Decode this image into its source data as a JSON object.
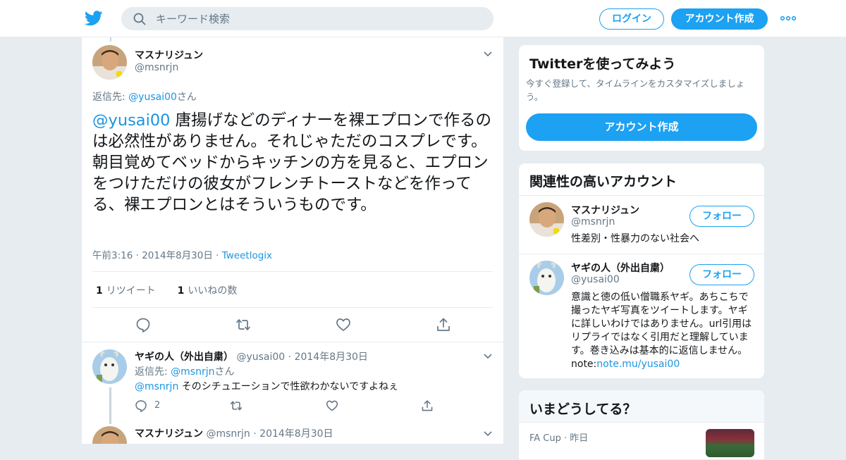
{
  "header": {
    "search_placeholder": "キーワード検索",
    "login_label": "ログイン",
    "signup_label": "アカウント作成",
    "brand_color": "#1da1f2"
  },
  "main_tweet": {
    "name": "マスナリジュン",
    "handle": "@msnrjn",
    "reply_prefix": "返信先: ",
    "reply_to": "@yusai00",
    "reply_suffix": "さん",
    "mention": "@yusai00",
    "text": " 唐揚げなどのディナーを裸エプロンで作るのは必然性がありません。それじゃただのコスプレです。朝目覚めてベッドからキッチンの方を見ると、エプロンをつけただけの彼女がフレンチトーストなどを作ってる、裸エプロンとはそういうものです。",
    "time": "午前3:16",
    "date": "2014年8月30日",
    "source": "Tweetlogix",
    "retweet_count": "1",
    "retweet_label": "リツイート",
    "like_count": "1",
    "like_label": "いいねの数"
  },
  "reply1": {
    "name": "ヤギの人（外出自粛）",
    "handle": "@yusai00",
    "date": "2014年8月30日",
    "reply_prefix": "返信先: ",
    "reply_to": "@msnrjn",
    "reply_suffix": "さん",
    "mention": "@msnrjn",
    "text": " そのシチュエーションで性欲わかないですよねぇ",
    "reply_count": "2"
  },
  "reply2": {
    "name": "マスナリジュン",
    "handle": "@msnrjn",
    "date": "2014年8月30日"
  },
  "signup_card": {
    "title": "Twitterを使ってみよう",
    "description": "今すぐ登録して、タイムラインをカスタマイズしましょう。",
    "button": "アカウント作成"
  },
  "related": {
    "title": "関連性の高いアカウント",
    "follow_label": "フォロー",
    "accounts": [
      {
        "name": "マスナリジュン",
        "handle": "@msnrjn",
        "bio": "性差別・性暴力のない社会へ"
      },
      {
        "name": "ヤギの人（外出自粛）",
        "handle": "@yusai00",
        "bio": "意識と徳の低い僧職系ヤギ。あちこちで撮ったヤギ写真をツイートします。ヤギに詳しいわけではありません。url引用はリプライではなく引用だと理解しています。巻き込みは基本的に返信しません。 note:",
        "bio_link": "note.mu/yusai00"
      }
    ]
  },
  "trends": {
    "title": "いまどうしてる？",
    "item_category": "FA Cup",
    "item_time": "昨日"
  }
}
